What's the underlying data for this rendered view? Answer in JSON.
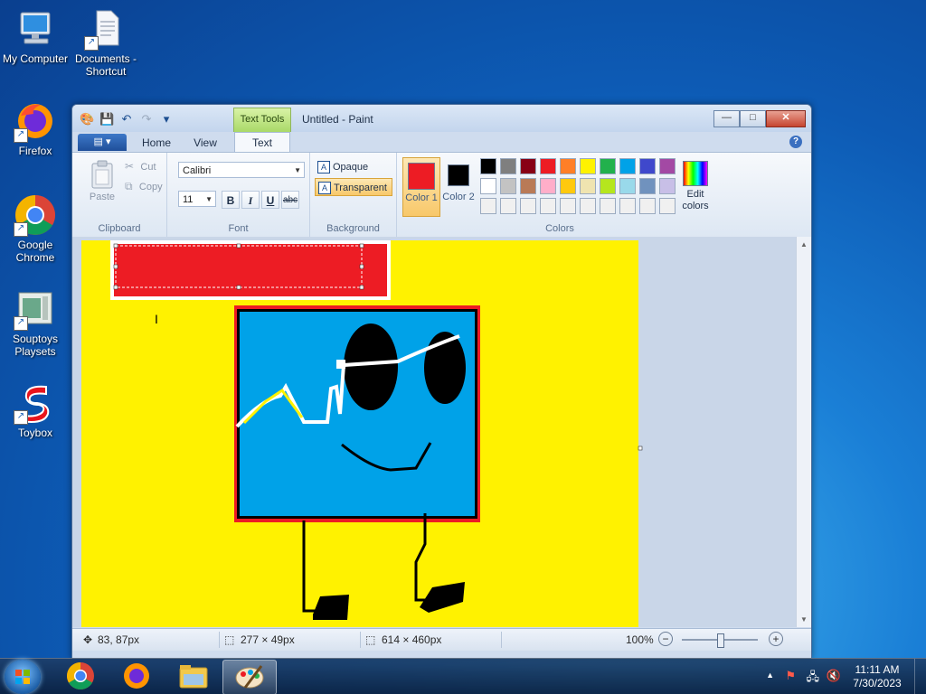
{
  "desktop": {
    "icons": [
      {
        "label": "My Computer"
      },
      {
        "label": "Documents - Shortcut"
      },
      {
        "label": "Firefox"
      },
      {
        "label": "Google Chrome"
      },
      {
        "label": "Souptoys Playsets"
      },
      {
        "label": "Toybox"
      }
    ]
  },
  "window": {
    "title": "Untitled - Paint",
    "contextual_tab": "Text Tools",
    "tabs": [
      "Home",
      "View",
      "Text"
    ],
    "active_tab": "Text",
    "controls": {
      "minimize": "—",
      "maximize": "□",
      "close": "✕"
    },
    "help": "?"
  },
  "ribbon": {
    "clipboard": {
      "label": "Clipboard",
      "paste": "Paste",
      "cut": "Cut",
      "copy": "Copy"
    },
    "font": {
      "label": "Font",
      "family": "Calibri",
      "size": "11",
      "bold": "B",
      "italic": "I",
      "underline": "U",
      "strikethrough": "abc"
    },
    "background": {
      "label": "Background",
      "opaque": "Opaque",
      "transparent": "Transparent",
      "selected": "Transparent"
    },
    "colors": {
      "label": "Colors",
      "color1_label": "Color 1",
      "color1": "#ed1c24",
      "color2_label": "Color 2",
      "color2": "#000000",
      "edit_colors": "Edit colors",
      "palette_row1": [
        "#000000",
        "#7f7f7f",
        "#880015",
        "#ed1c24",
        "#ff7f27",
        "#fff200",
        "#22b14c",
        "#00a2e8",
        "#3f48cc",
        "#a349a4"
      ],
      "palette_row2": [
        "#ffffff",
        "#c3c3c3",
        "#b97a57",
        "#ffaec9",
        "#ffc90e",
        "#efe4b0",
        "#b5e61d",
        "#99d9ea",
        "#7092be",
        "#c8bfe7"
      ],
      "palette_row3": [
        "#f0f0f0",
        "#f0f0f0",
        "#f0f0f0",
        "#f0f0f0",
        "#f0f0f0",
        "#f0f0f0",
        "#f0f0f0",
        "#f0f0f0",
        "#f0f0f0",
        "#f0f0f0"
      ]
    }
  },
  "status": {
    "cursor_pos": "83, 87px",
    "selection_size": "277 × 49px",
    "image_size": "614 × 460px",
    "zoom": "100%"
  },
  "taskbar": {
    "time": "11:11 AM",
    "date": "7/30/2023"
  }
}
